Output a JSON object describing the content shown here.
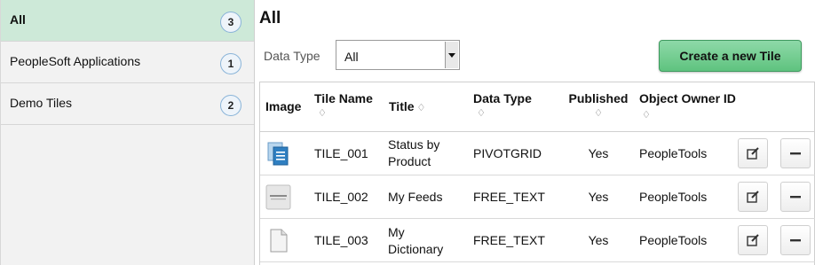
{
  "sidebar": {
    "items": [
      {
        "label": "All",
        "count": "3",
        "active": true
      },
      {
        "label": "PeopleSoft Applications",
        "count": "1",
        "active": false
      },
      {
        "label": "Demo Tiles",
        "count": "2",
        "active": false
      }
    ]
  },
  "main": {
    "title": "All",
    "filter": {
      "label": "Data Type",
      "value": "All"
    },
    "create_button": "Create a new Tile"
  },
  "grid": {
    "headers": {
      "image": "Image",
      "tile_name": "Tile Name",
      "title": "Title",
      "data_type": "Data Type",
      "published": "Published",
      "owner": "Object Owner ID"
    },
    "rows": [
      {
        "tile_name": "TILE_001",
        "title": "Status by Product",
        "data_type": "PIVOTGRID",
        "published": "Yes",
        "owner": "PeopleTools",
        "icon": "document-chart-icon"
      },
      {
        "tile_name": "TILE_002",
        "title": "My Feeds",
        "data_type": "FREE_TEXT",
        "published": "Yes",
        "owner": "PeopleTools",
        "icon": "oracle-logo-icon"
      },
      {
        "tile_name": "TILE_003",
        "title": "My Dictionary",
        "data_type": "FREE_TEXT",
        "published": "Yes",
        "owner": "PeopleTools",
        "icon": "blank-document-icon"
      }
    ]
  },
  "colors": {
    "active_item": "#cde9d8",
    "create_button": "#5fc37f",
    "badge_border": "#8ab4d8"
  }
}
